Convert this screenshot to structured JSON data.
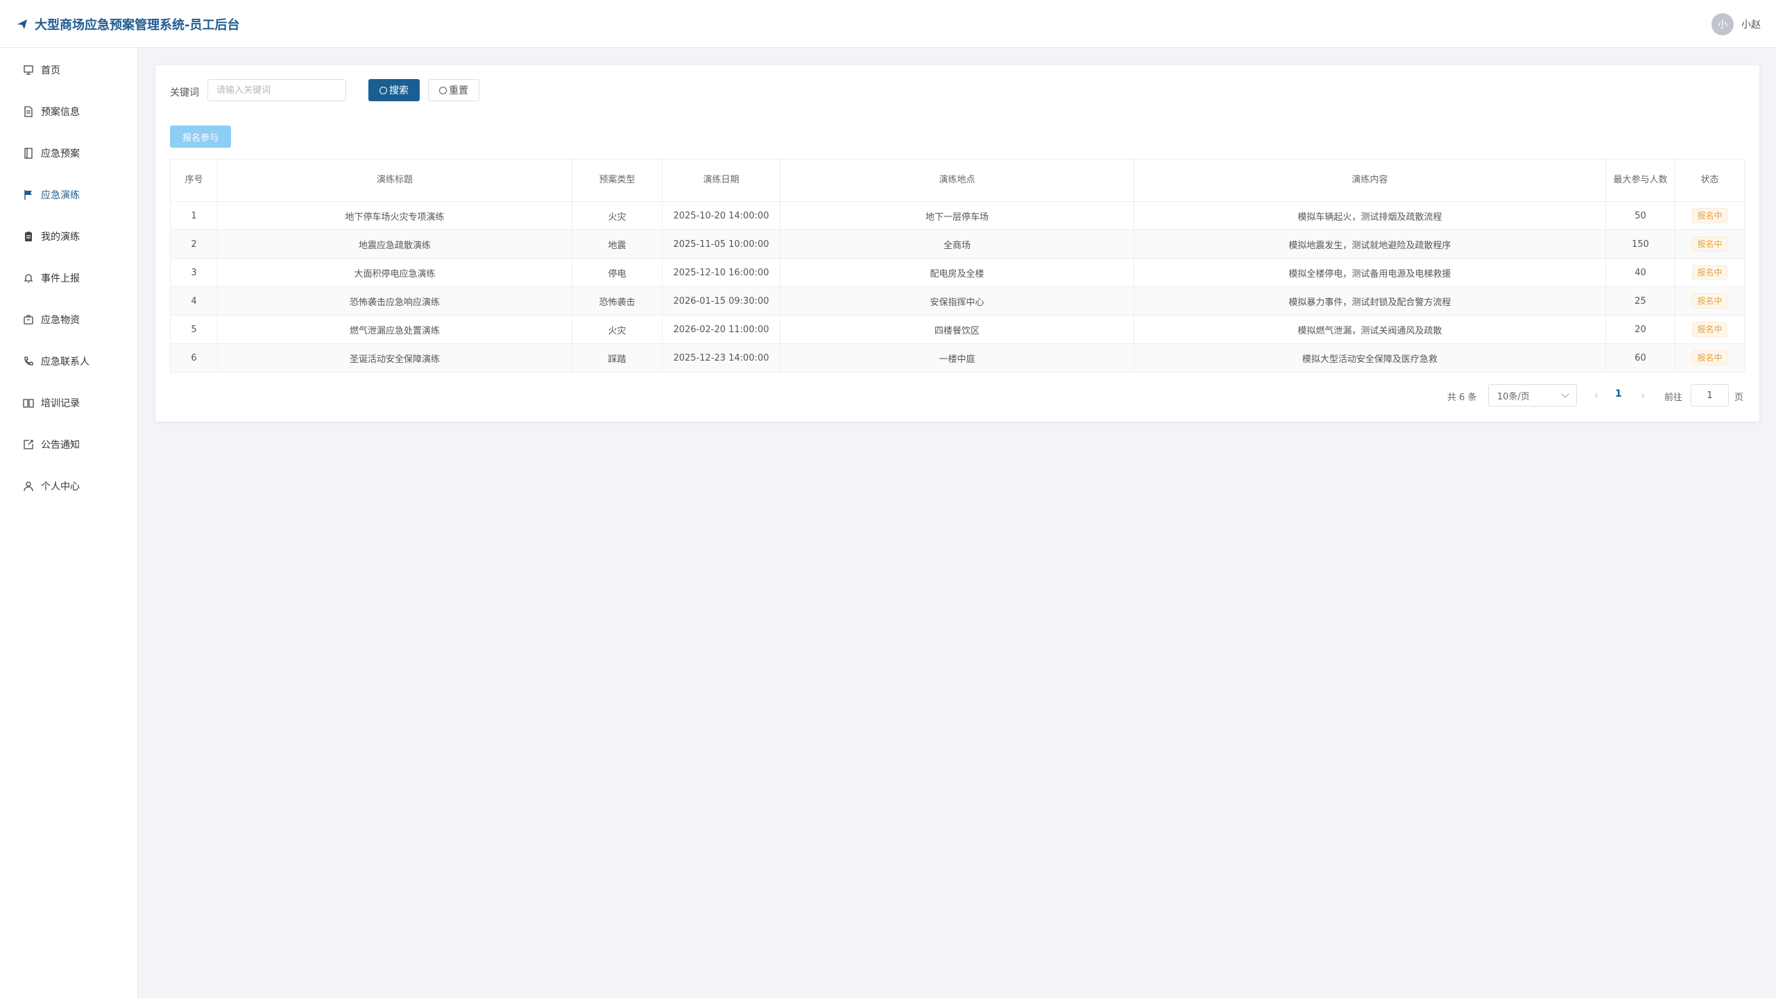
{
  "app": {
    "title": "大型商场应急预案管理系统-员工后台"
  },
  "user": {
    "avatar_text": "小",
    "name": "小赵"
  },
  "sidebar": {
    "items": [
      {
        "label": "首页",
        "icon": "home-icon"
      },
      {
        "label": "预案信息",
        "icon": "document-icon"
      },
      {
        "label": "应急预案",
        "icon": "notebook-icon"
      },
      {
        "label": "应急演练",
        "icon": "flag-icon",
        "active": true
      },
      {
        "label": "我的演练",
        "icon": "clipboard-icon"
      },
      {
        "label": "事件上报",
        "icon": "bell-icon"
      },
      {
        "label": "应急物资",
        "icon": "box-icon"
      },
      {
        "label": "应急联系人",
        "icon": "phone-icon"
      },
      {
        "label": "培训记录",
        "icon": "book-icon"
      },
      {
        "label": "公告通知",
        "icon": "notice-icon"
      },
      {
        "label": "个人中心",
        "icon": "user-icon"
      }
    ]
  },
  "search": {
    "label": "关键词",
    "placeholder": "请输入关键词",
    "value": "",
    "search_button": "搜索",
    "reset_button": "重置"
  },
  "actions": {
    "signup_button": "报名参与"
  },
  "table": {
    "headers": [
      "序号",
      "演练标题",
      "预案类型",
      "演练日期",
      "演练地点",
      "演练内容",
      "最大参与人数",
      "状态"
    ],
    "rows": [
      {
        "no": "1",
        "title": "地下停车场火灾专项演练",
        "type": "火灾",
        "date": "2025-10-20 14:00:00",
        "location": "地下一层停车场",
        "content": "模拟车辆起火，测试排烟及疏散流程",
        "max": "50",
        "status": "报名中"
      },
      {
        "no": "2",
        "title": "地震应急疏散演练",
        "type": "地震",
        "date": "2025-11-05 10:00:00",
        "location": "全商场",
        "content": "模拟地震发生，测试就地避险及疏散程序",
        "max": "150",
        "status": "报名中"
      },
      {
        "no": "3",
        "title": "大面积停电应急演练",
        "type": "停电",
        "date": "2025-12-10 16:00:00",
        "location": "配电房及全楼",
        "content": "模拟全楼停电，测试备用电源及电梯救援",
        "max": "40",
        "status": "报名中"
      },
      {
        "no": "4",
        "title": "恐怖袭击应急响应演练",
        "type": "恐怖袭击",
        "date": "2026-01-15 09:30:00",
        "location": "安保指挥中心",
        "content": "模拟暴力事件，测试封锁及配合警方流程",
        "max": "25",
        "status": "报名中"
      },
      {
        "no": "5",
        "title": "燃气泄漏应急处置演练",
        "type": "火灾",
        "date": "2026-02-20 11:00:00",
        "location": "四楼餐饮区",
        "content": "模拟燃气泄漏，测试关阀通风及疏散",
        "max": "20",
        "status": "报名中"
      },
      {
        "no": "6",
        "title": "圣诞活动安全保障演练",
        "type": "踩踏",
        "date": "2025-12-23 14:00:00",
        "location": "一楼中庭",
        "content": "模拟大型活动安全保障及医疗急救",
        "max": "60",
        "status": "报名中"
      }
    ]
  },
  "pagination": {
    "total": "共 6 条",
    "page_size": "10条/页",
    "current": "1",
    "goto_label": "前往",
    "goto_value": "1",
    "page_suffix": "页"
  },
  "colors": {
    "primary": "#1b5f92",
    "brand_text": "#1f5c8f",
    "warning": "#e6a23c"
  }
}
